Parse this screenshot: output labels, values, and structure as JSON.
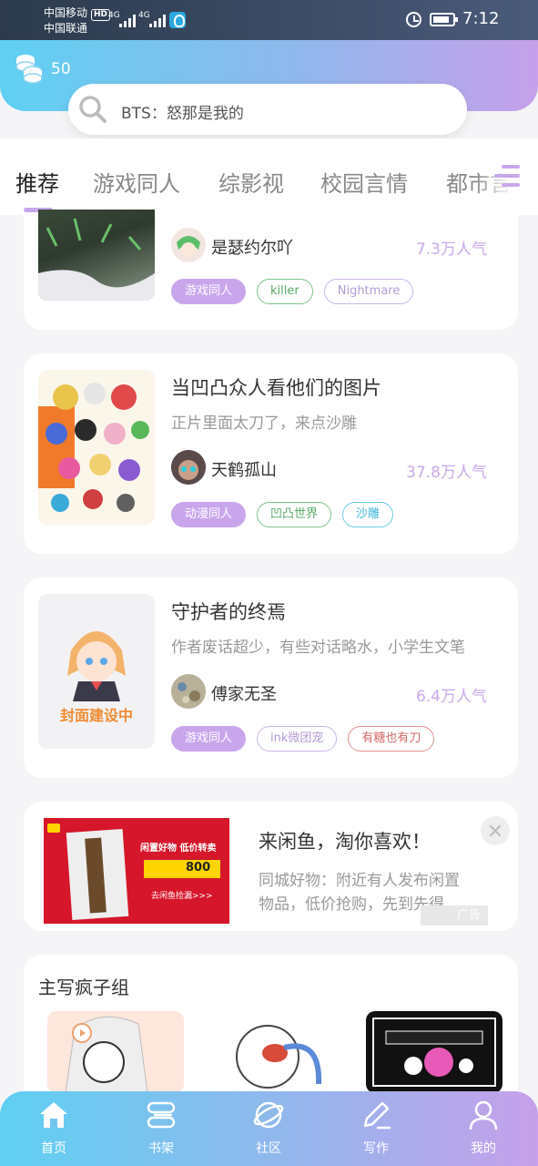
{
  "status_bar": {
    "carrier1": "中国移动",
    "hd": "HD",
    "carrier2": "中国联通",
    "net1": "4G",
    "net2": "4G",
    "time": "7:12"
  },
  "header": {
    "coins": "50",
    "search_placeholder": "BTS：怒那是我的"
  },
  "tabs": [
    {
      "label": "推荐",
      "active": true
    },
    {
      "label": "游戏同人"
    },
    {
      "label": "综影视"
    },
    {
      "label": "校园言情"
    },
    {
      "label": "都市言情"
    }
  ],
  "books": [
    {
      "author": "是瑟约尔吖",
      "popularity": "7.3万人气",
      "tags": [
        "游戏同人",
        "killer",
        "Nightmare"
      ]
    },
    {
      "title": "当凹凸众人看他们的图片",
      "desc": "正片里面太刀了，来点沙雕",
      "author": "天鹤孤山",
      "popularity": "37.8万人气",
      "tags": [
        "动漫同人",
        "凹凸世界",
        "沙雕"
      ]
    },
    {
      "title": "守护者的终焉",
      "desc": "作者废话超少，有些对话略水，小学生文笔",
      "author": "傅家无圣",
      "popularity": "6.4万人气",
      "tags": [
        "游戏同人",
        "ink微团宠",
        "有糖也有刀"
      ],
      "cover_text": "封面建设中"
    }
  ],
  "ad": {
    "title": "来闲鱼，淘你喜欢！",
    "desc": "同城好物：附近有人发布闲置物品，低价抢购，先到先得",
    "badge": "广告",
    "image_text_top": "闲置好物 低价转卖",
    "image_text_price": "800",
    "image_text_bottom": "去闲鱼捡漏>>>"
  },
  "section": {
    "title": "主写疯子组"
  },
  "bottom_nav": [
    {
      "label": "首页",
      "icon": "home-icon"
    },
    {
      "label": "书架",
      "icon": "bookshelf-icon"
    },
    {
      "label": "社区",
      "icon": "planet-icon"
    },
    {
      "label": "写作",
      "icon": "pen-icon"
    },
    {
      "label": "我的",
      "icon": "user-icon"
    }
  ],
  "colors": {
    "accent_purple": "#c9a6ec",
    "accent_cyan": "#5fd0f2"
  }
}
